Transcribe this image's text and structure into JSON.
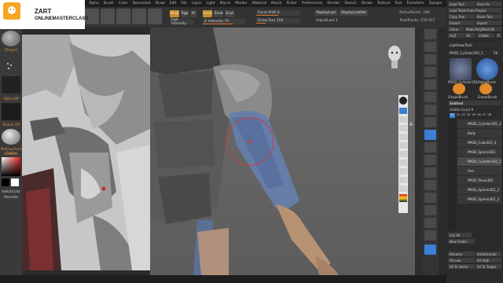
{
  "menu": [
    "Alpha",
    "Brush",
    "Color",
    "Document",
    "Draw",
    "Edit",
    "File",
    "Layer",
    "Light",
    "Macro",
    "Marker",
    "Material",
    "Movie",
    "Picker",
    "Preferences",
    "Render",
    "Stencil",
    "Stroke",
    "Texture",
    "Tool",
    "Transform",
    "Zplugin",
    "Zscript",
    "Help"
  ],
  "logo": {
    "line1": "ZART",
    "line2": "ONLINEMASTERCLASS"
  },
  "toolbar": {
    "mrgb": "Mrgb",
    "rgb": "Rgb",
    "m": "M",
    "zadd": "Zadd",
    "zsub": "Zsub",
    "zcut": "Zcut",
    "rgb_intensity": "Rgb Intensity",
    "z_intensity": "Z Intensity 70",
    "focal_shift": "Focal Shift 0",
    "draw_size": "Draw Size 104",
    "replaylast": "ReplayLast",
    "replaylastrel": "ReplayLastRel",
    "dynamic": "Dynamic",
    "active_points": "ActivePoints: 16K",
    "total_points": "TotalPoints: 235.817",
    "adjust_last": "AdjustLast 1"
  },
  "left_shelf": {
    "projection": "ZProject",
    "alpha": "Alpha Off",
    "texture": "Texture Off",
    "matcap": "MatCap Pearl Cavity",
    "gradient": "Gradient",
    "switch": "SwitchColor",
    "alternate": "Alternate"
  },
  "right_panel": {
    "top_buttons": [
      "Load Tool",
      "Save As",
      "Load Tools From Project",
      "Copy Tool",
      "Paste Tool",
      "Import",
      "Export",
      "Clone",
      "Make PolyMesh3D",
      "GoZ",
      "All",
      "Visible",
      "R"
    ],
    "lightbox": "Lightbox▸Tools",
    "current_tool": "PM3D_Cylinder3D1_5",
    "current_tool_count": "58",
    "thumbs": [
      "PM3D_Cylinder3D1",
      "AlphaBrush",
      "SimpleBrush",
      "EraserBrush"
    ],
    "subtool_header": "Subtool",
    "visible_count": "Visible Count 9",
    "subtool_cols": [
      "V1",
      "V2",
      "V3",
      "V4",
      "V5",
      "V6",
      "V7",
      "V8"
    ],
    "subtools": [
      "PM3D_Cylinder3D1_3",
      "Body",
      "PM3D_Cube3D1_4",
      "PM3D_Sphere3D1",
      "PM3D_Cylinder3D1_5",
      "Arm",
      "PM3D_Plane3D1",
      "PM3D_Sphere3D1_1",
      "PM3D_Sphere3D1_2"
    ],
    "bottom_buttons": [
      "List All",
      "New Folder",
      "Rename",
      "All Low",
      "All To Home",
      "AutoReorder",
      "All High",
      "All To Target"
    ]
  },
  "right_toolbar": {
    "labels": [
      "Floor",
      "Local",
      "Xyz",
      "Frame",
      "Move",
      "Scale",
      "Rotate",
      "PolyF",
      "Transp",
      "Ghost",
      "Solo",
      "Xpose"
    ]
  }
}
